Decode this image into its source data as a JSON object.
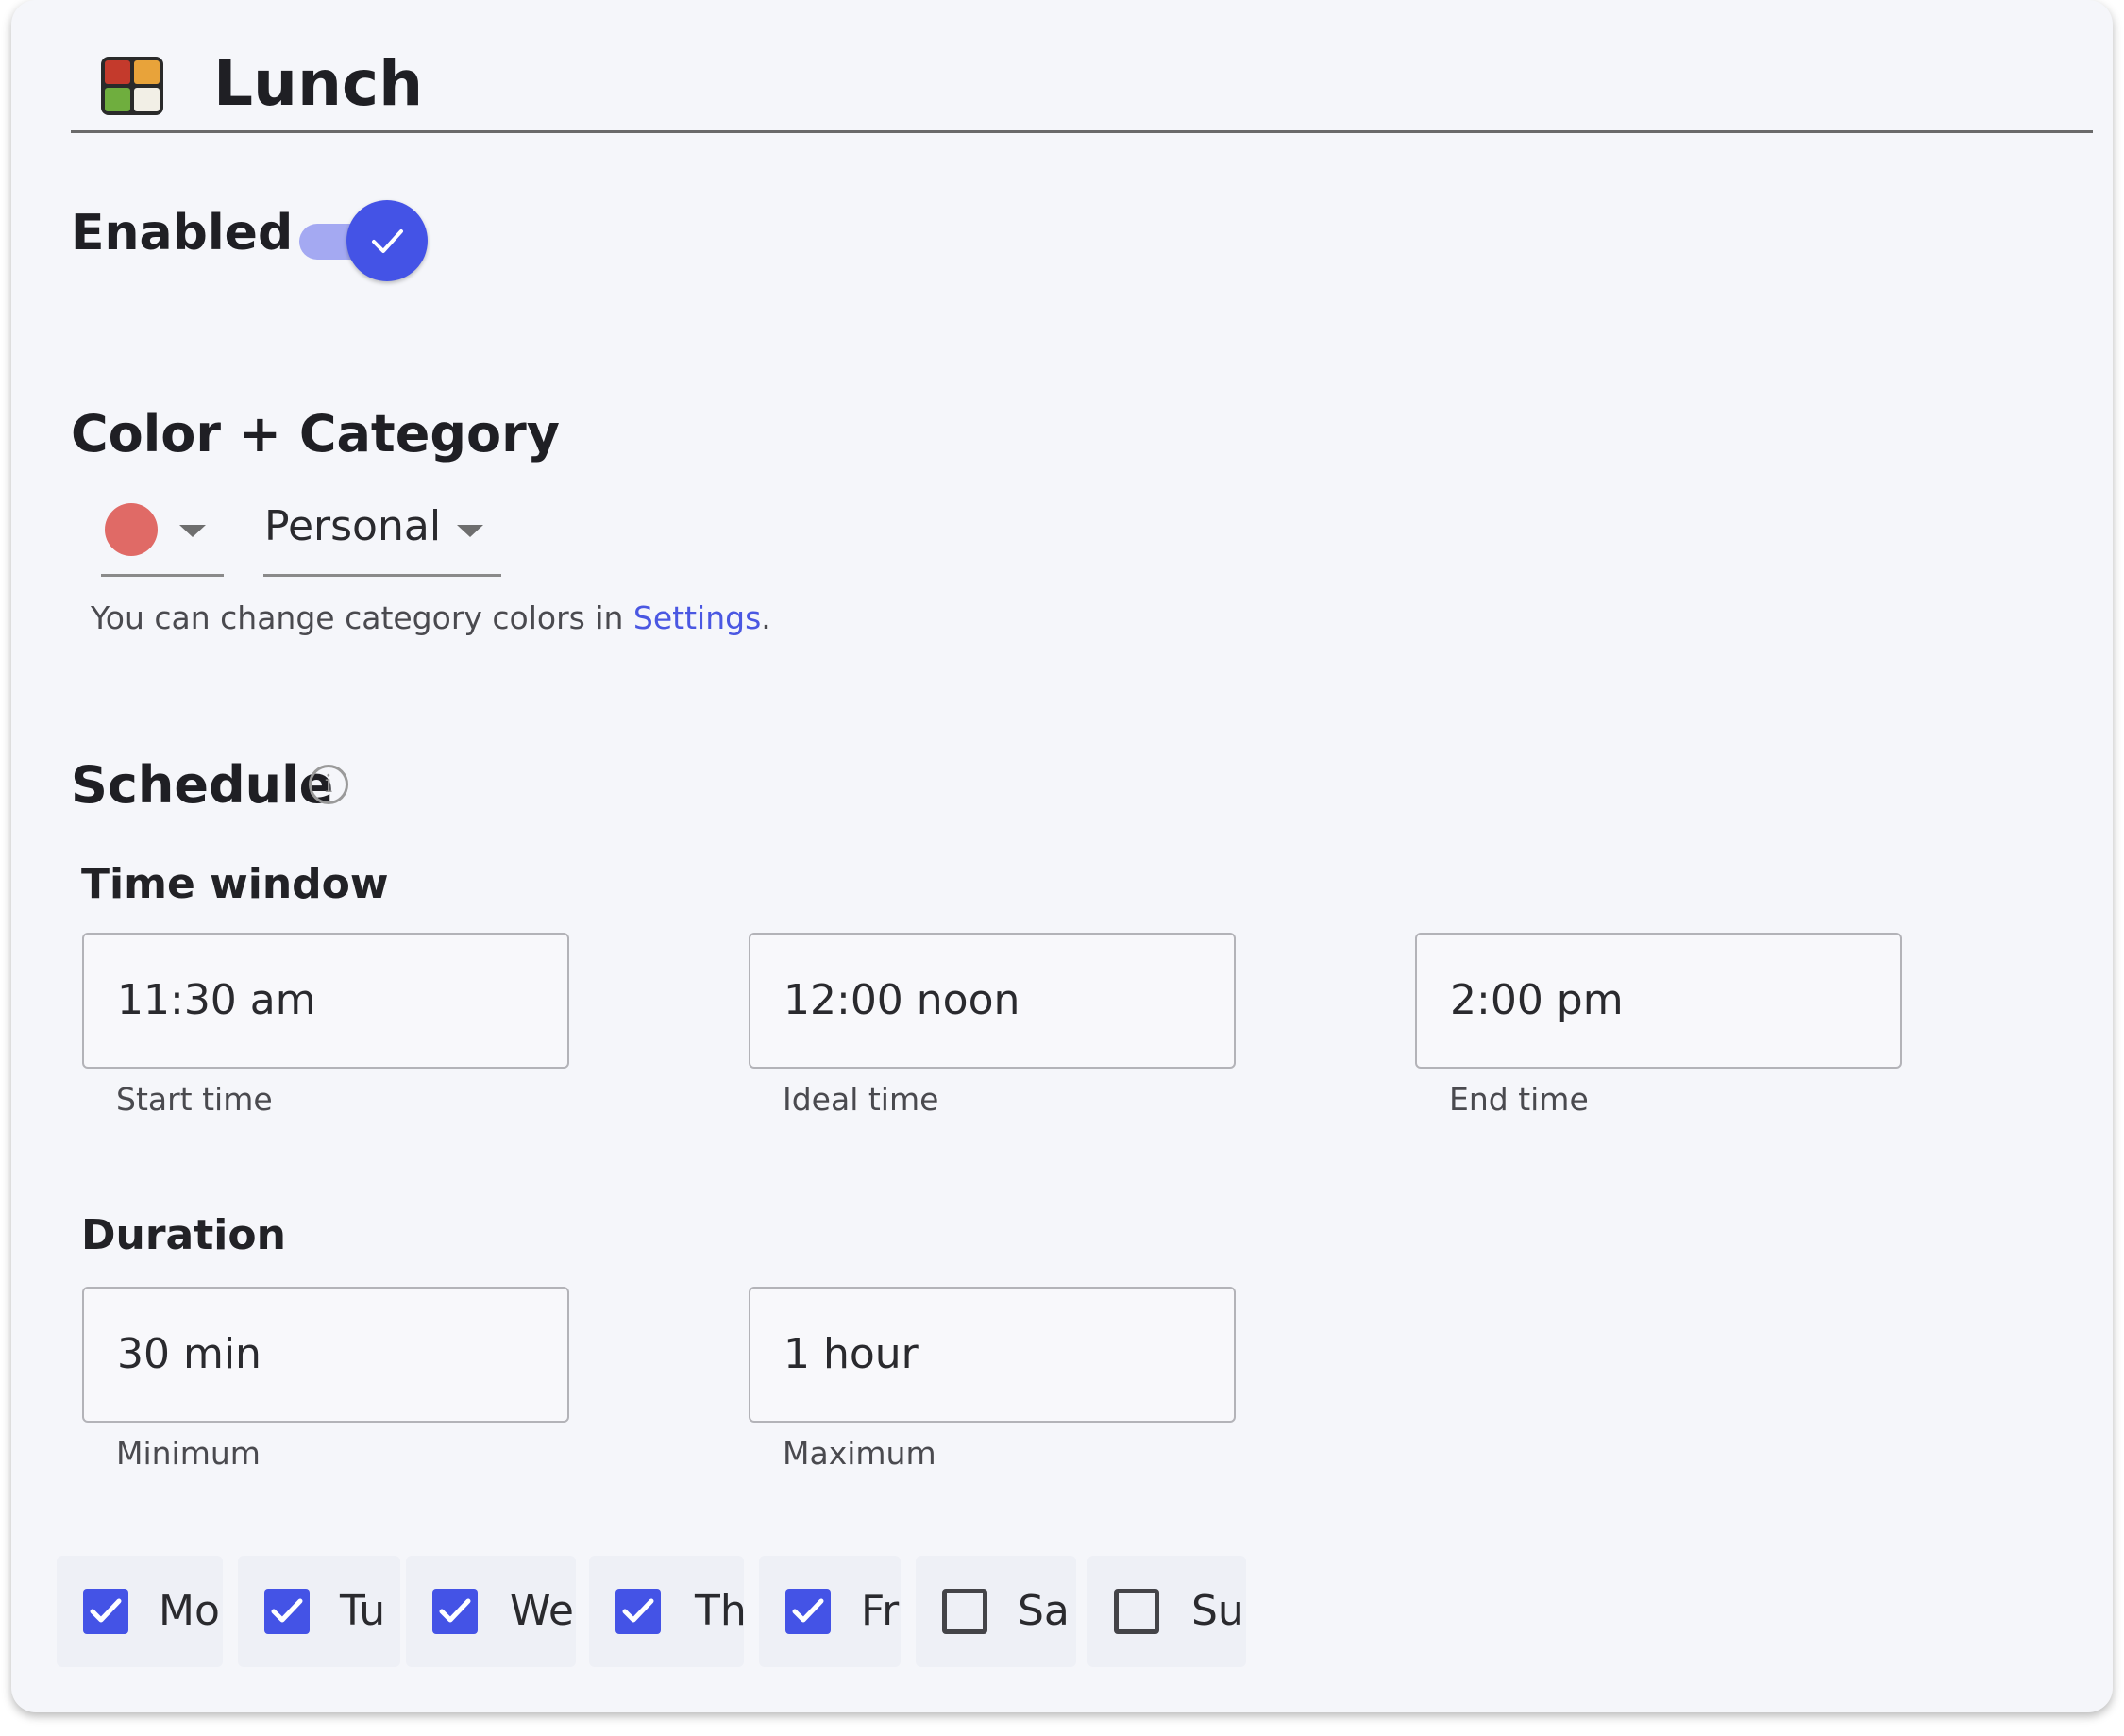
{
  "header": {
    "icon": "bento-box-icon",
    "title": "Lunch"
  },
  "enabled": {
    "label": "Enabled",
    "value": true
  },
  "color_category": {
    "heading": "Color + Category",
    "color": "#e06a66",
    "category": "Personal",
    "helper_prefix": "You can change category colors in ",
    "helper_link": "Settings",
    "helper_suffix": "."
  },
  "schedule": {
    "heading": "Schedule",
    "time_window": {
      "heading": "Time window",
      "fields": [
        {
          "value": "11:30 am",
          "caption": "Start time"
        },
        {
          "value": "12:00 noon",
          "caption": "Ideal time"
        },
        {
          "value": "2:00 pm",
          "caption": "End time"
        }
      ]
    },
    "duration": {
      "heading": "Duration",
      "fields": [
        {
          "value": "30 min",
          "caption": "Minimum"
        },
        {
          "value": "1 hour",
          "caption": "Maximum"
        }
      ]
    },
    "days": [
      {
        "label": "Mo",
        "checked": true
      },
      {
        "label": "Tu",
        "checked": true
      },
      {
        "label": "We",
        "checked": true
      },
      {
        "label": "Th",
        "checked": true
      },
      {
        "label": "Fr",
        "checked": true
      },
      {
        "label": "Sa",
        "checked": false
      },
      {
        "label": "Su",
        "checked": false
      }
    ]
  },
  "colors": {
    "accent": "#4453e6",
    "accent_light": "#a4a9f2",
    "link": "#4a57e2",
    "card_background": "#f5f6fa"
  }
}
